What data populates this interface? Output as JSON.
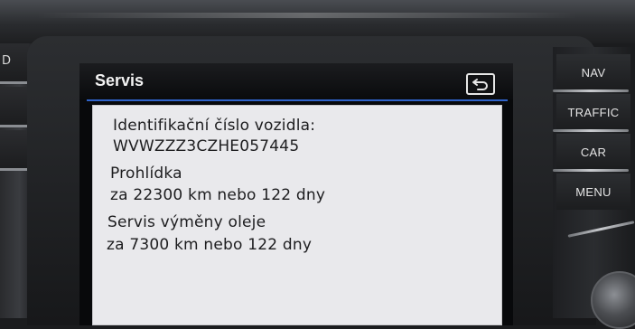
{
  "screen": {
    "title": "Servis",
    "back_icon": "back-arrow-icon",
    "lines": [
      "Identifikační číslo vozidla:",
      "WVWZZZ3CZHE057445",
      "Prohlídka",
      "za 22300 km nebo 122 dny",
      "Servis výměny oleje",
      "za 7300 km nebo 122 dny"
    ]
  },
  "hardware_buttons": {
    "right": [
      "NAV",
      "TRAFFIC",
      "CAR",
      "MENU"
    ],
    "left_partial": "D"
  },
  "colors": {
    "accent_line": "#2f63c9",
    "panel_bg": "#e9e9ec",
    "screen_bg": "#08090b"
  }
}
